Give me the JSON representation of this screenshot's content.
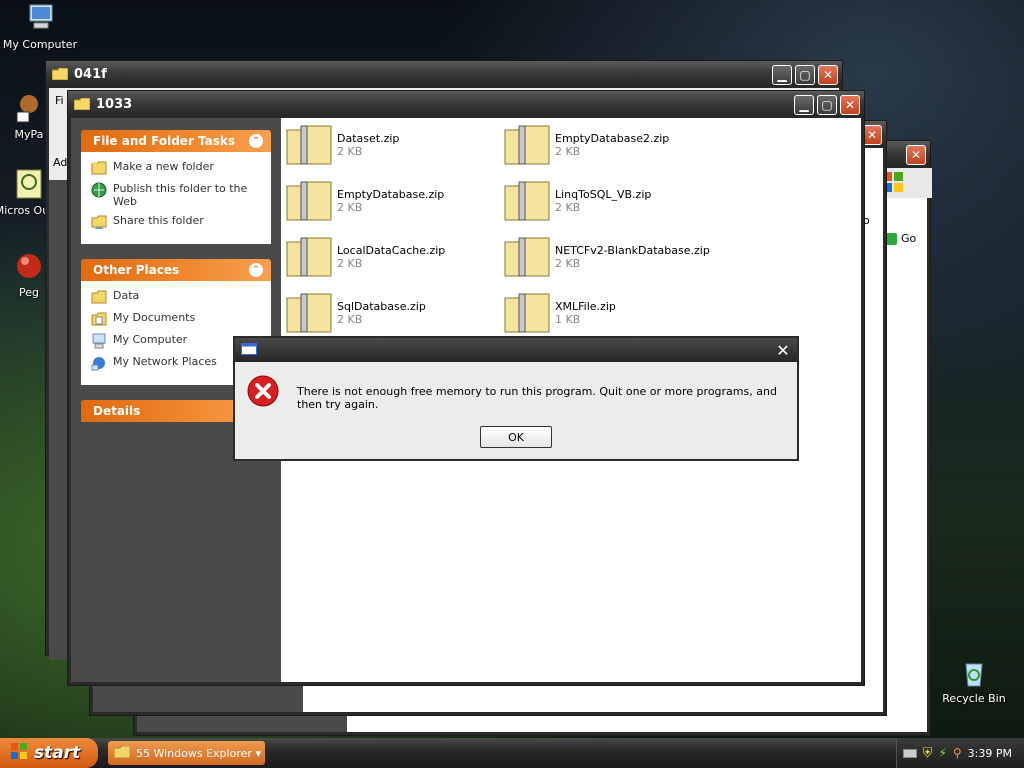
{
  "desktop": {
    "icons": [
      {
        "label": "My Computer"
      },
      {
        "label": "MyPa"
      },
      {
        "label": "Micros Outlo"
      },
      {
        "label": "Peg"
      },
      {
        "label": "Recycle Bin"
      }
    ]
  },
  "windows": {
    "w041f": {
      "title": "041f",
      "menu_fragment": "Fi",
      "address_fragment": "Ad"
    },
    "back": {
      "go_label": "Go",
      "fragment": "o"
    },
    "main": {
      "title": "1033",
      "task_panels": [
        {
          "title": "File and Folder Tasks",
          "items": [
            "Make a new folder",
            "Publish this folder to the Web",
            "Share this folder"
          ]
        },
        {
          "title": "Other Places",
          "items": [
            "Data",
            "My Documents",
            "My Computer",
            "My Network Places"
          ]
        },
        {
          "title": "Details",
          "items": []
        }
      ],
      "files": [
        {
          "name": "Dataset.zip",
          "size": "2 KB"
        },
        {
          "name": "EmptyDatabase2.zip",
          "size": "2 KB"
        },
        {
          "name": "EmptyDatabase.zip",
          "size": "2 KB"
        },
        {
          "name": "LinqToSQL_VB.zip",
          "size": "2 KB"
        },
        {
          "name": "LocalDataCache.zip",
          "size": "2 KB"
        },
        {
          "name": "NETCFv2-BlankDatabase.zip",
          "size": "2 KB"
        },
        {
          "name": "SqlDatabase.zip",
          "size": "2 KB"
        },
        {
          "name": "XMLFile.zip",
          "size": "1 KB"
        }
      ]
    }
  },
  "dialog": {
    "message": "There is not enough free memory to run this program. Quit one or more programs, and then try again.",
    "ok_label": "OK"
  },
  "taskbar": {
    "start_label": "start",
    "task_label": "55 Windows Explorer",
    "clock": "3:39 PM"
  },
  "colors": {
    "accent_orange": "#e06a10",
    "error_red": "#d81e1e"
  }
}
